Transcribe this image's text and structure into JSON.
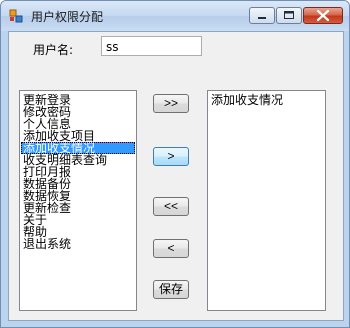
{
  "window": {
    "title": "用户权限分配"
  },
  "form": {
    "user_label": "用户名:",
    "user_value": "ss"
  },
  "available_list": {
    "items": [
      "更新登录",
      "修改密码",
      "个人信息",
      "添加收支项目",
      "添加收支情况",
      "收支明细表查询",
      "打印月报",
      "数据备份",
      "数据恢复",
      "更新检查",
      "关于",
      "帮助",
      "退出系统"
    ],
    "selected_index": 4
  },
  "assigned_list": {
    "items": [
      "添加收支情况"
    ]
  },
  "buttons": {
    "add_all": ">>",
    "add": ">",
    "remove_all": "<<",
    "remove": "<",
    "save": "保存"
  }
}
